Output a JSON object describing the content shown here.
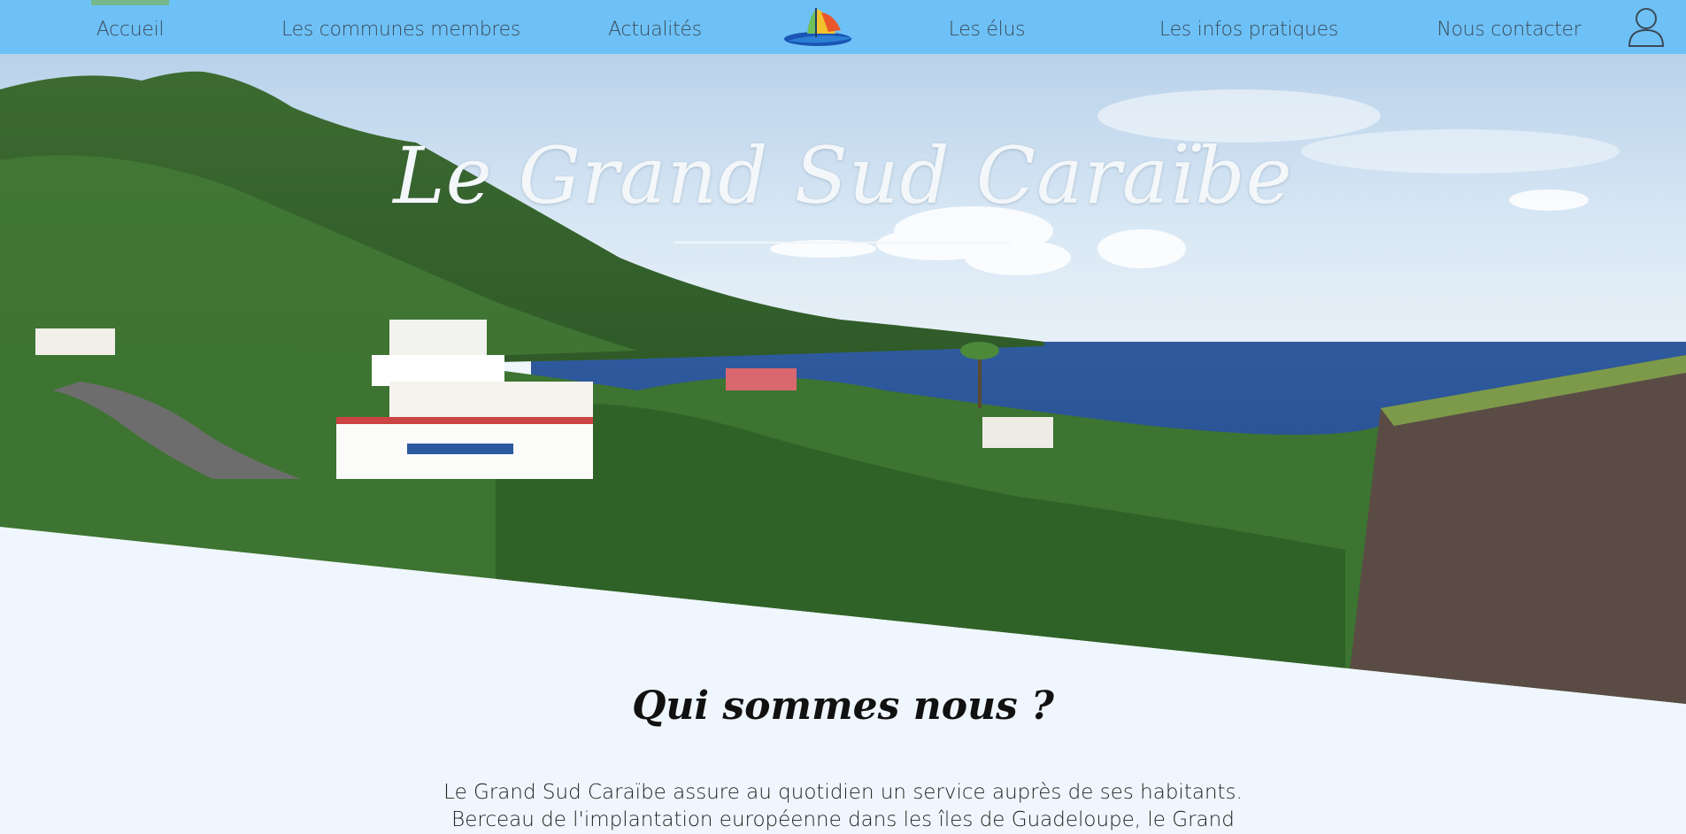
{
  "nav": {
    "items": [
      {
        "label": "Accueil",
        "active": true
      },
      {
        "label": "Les communes membres",
        "active": false
      },
      {
        "label": "Actualités",
        "active": false
      },
      {
        "label": "Les élus",
        "active": false
      },
      {
        "label": "Les infos pratiques",
        "active": false
      },
      {
        "label": "Nous contacter",
        "active": false
      }
    ],
    "logo_icon": "sailboat-logo-icon",
    "user_icon": "user-icon"
  },
  "hero": {
    "title": "Le Grand Sud Caraïbe"
  },
  "about": {
    "title": "Qui sommes nous ?",
    "lines": [
      "Le Grand Sud Caraïbe assure au quotidien un service auprès de ses habitants.",
      "Berceau de l'implantation européenne dans les îles de Guadeloupe, le Grand"
    ]
  },
  "colors": {
    "nav_bg": "#6ec1f6",
    "nav_active_indicator": "#74b88c",
    "page_bg": "#eff6fd",
    "sea": "#2f5a9e"
  }
}
